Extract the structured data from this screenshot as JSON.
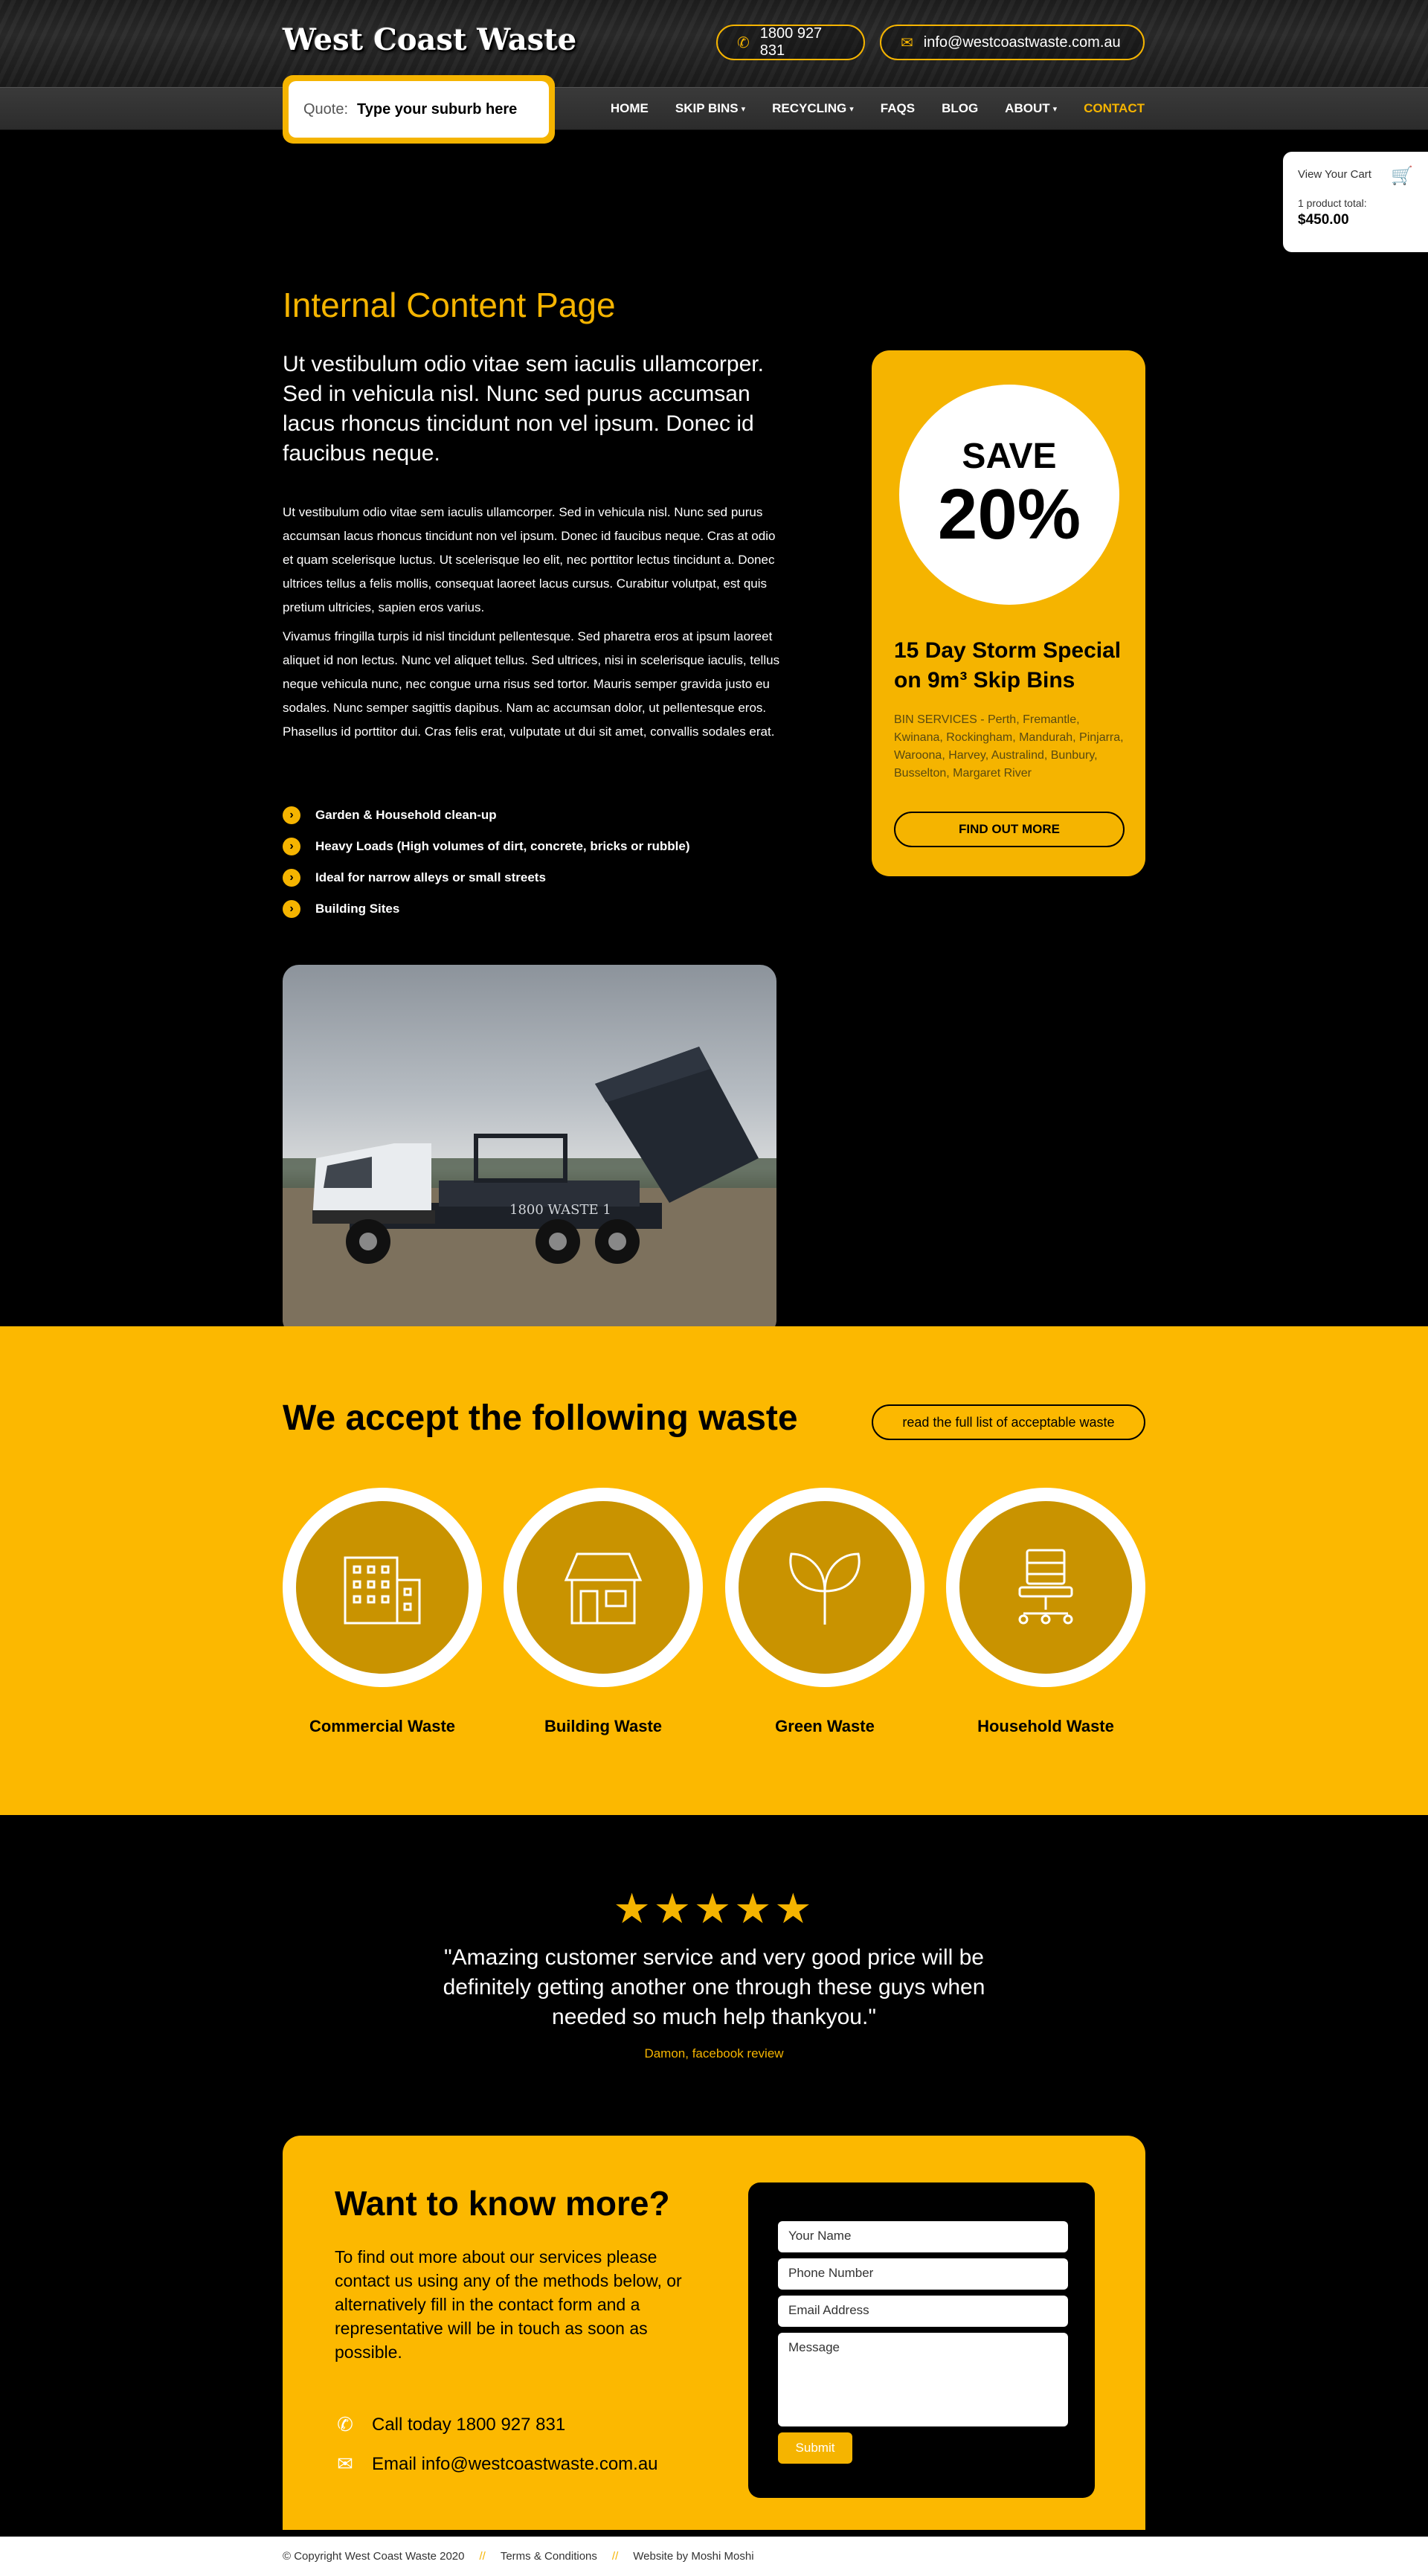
{
  "header": {
    "logo": "West Coast Waste",
    "phone": "1800 927 831",
    "email": "info@westcoastwaste.com.au"
  },
  "quote": {
    "label": "Quote:",
    "placeholder": "Type your suburb here"
  },
  "nav": [
    {
      "label": "HOME",
      "has_dropdown": false
    },
    {
      "label": "SKIP BINS",
      "has_dropdown": true
    },
    {
      "label": "RECYCLING",
      "has_dropdown": true
    },
    {
      "label": "FAQS",
      "has_dropdown": false
    },
    {
      "label": "BLOG",
      "has_dropdown": false
    },
    {
      "label": "ABOUT",
      "has_dropdown": true
    },
    {
      "label": "CONTACT",
      "has_dropdown": false,
      "active": true
    }
  ],
  "cart": {
    "view": "View Your Cart",
    "product_total_label": "1 product total:",
    "total": "$450.00"
  },
  "content": {
    "title": "Internal Content Page",
    "lead": "Ut vestibulum odio vitae sem iaculis ullamcorper. Sed in vehicula nisl. Nunc sed purus accumsan lacus rhoncus tincidunt non vel ipsum. Donec id faucibus neque.",
    "para1": "Ut vestibulum odio vitae sem iaculis ullamcorper. Sed in vehicula nisl. Nunc sed purus accumsan lacus rhoncus tincidunt non vel ipsum. Donec id faucibus neque. Cras at odio et quam scelerisque luctus. Ut scelerisque leo elit, nec porttitor lectus tincidunt a. Donec ultrices tellus a felis mollis, consequat laoreet lacus cursus. Curabitur volutpat, est quis pretium ultricies, sapien eros varius.",
    "para2": "Vivamus fringilla turpis id nisl tincidunt pellentesque. Sed pharetra eros at ipsum laoreet aliquet id non lectus. Nunc vel aliquet tellus. Sed ultrices, nisi in scelerisque iaculis, tellus neque vehicula nunc, nec congue urna risus sed tortor. Mauris semper gravida justo eu sodales. Nunc semper sagittis dapibus. Nam ac accumsan dolor, ut pellentesque eros. Phasellus id porttitor dui. Cras felis erat, vulputate ut dui sit amet, convallis sodales erat.",
    "bullets": [
      "Garden & Household clean-up",
      "Heavy Loads (High volumes of dirt, concrete, bricks or rubble)",
      "Ideal for narrow alleys or small streets",
      "Building Sites"
    ],
    "truck_text": "1800 WASTE 1"
  },
  "promo": {
    "save": "SAVE",
    "percent": "20%",
    "title": "15 Day Storm Special on 9m³ Skip Bins",
    "desc": "BIN SERVICES - Perth, Fremantle, Kwinana, Rockingham, Mandurah, Pinjarra, Waroona, Harvey, Australind, Bunbury, Busselton, Margaret River",
    "button": "FIND OUT MORE"
  },
  "waste": {
    "title": "We accept the following waste",
    "link": "read the full list of acceptable waste",
    "items": [
      {
        "label": "Commercial Waste",
        "icon": "building-icon"
      },
      {
        "label": "Building Waste",
        "icon": "house-icon"
      },
      {
        "label": "Green Waste",
        "icon": "leaf-icon"
      },
      {
        "label": "Household Waste",
        "icon": "chair-icon"
      }
    ]
  },
  "testimonial": {
    "stars": "★★★★★",
    "rating": 5,
    "quote": "\"Amazing customer service and very good price will be definitely getting another one through these guys when needed so much help thankyou.\"",
    "author": "Damon, facebook review"
  },
  "contact": {
    "title": "Want to know more?",
    "text": "To find out more about our services please contact us using any of the methods below, or alternatively fill in the contact form and a representative will be in touch as soon as possible.",
    "call": "Call today 1800 927 831",
    "email": "Email info@westcoastwaste.com.au",
    "form": {
      "name": "Your Name",
      "phone": "Phone Number",
      "email": "Email Address",
      "message": "Message",
      "submit": "Submit"
    }
  },
  "footer": {
    "copyright": "© Copyright West Coast Waste 2020",
    "sep": "//",
    "terms": "Terms & Conditions",
    "credit": "Website by Moshi Moshi"
  },
  "colors": {
    "accent": "#f5b400",
    "section_yellow": "#fcb800",
    "icon_circle": "#c99300"
  }
}
